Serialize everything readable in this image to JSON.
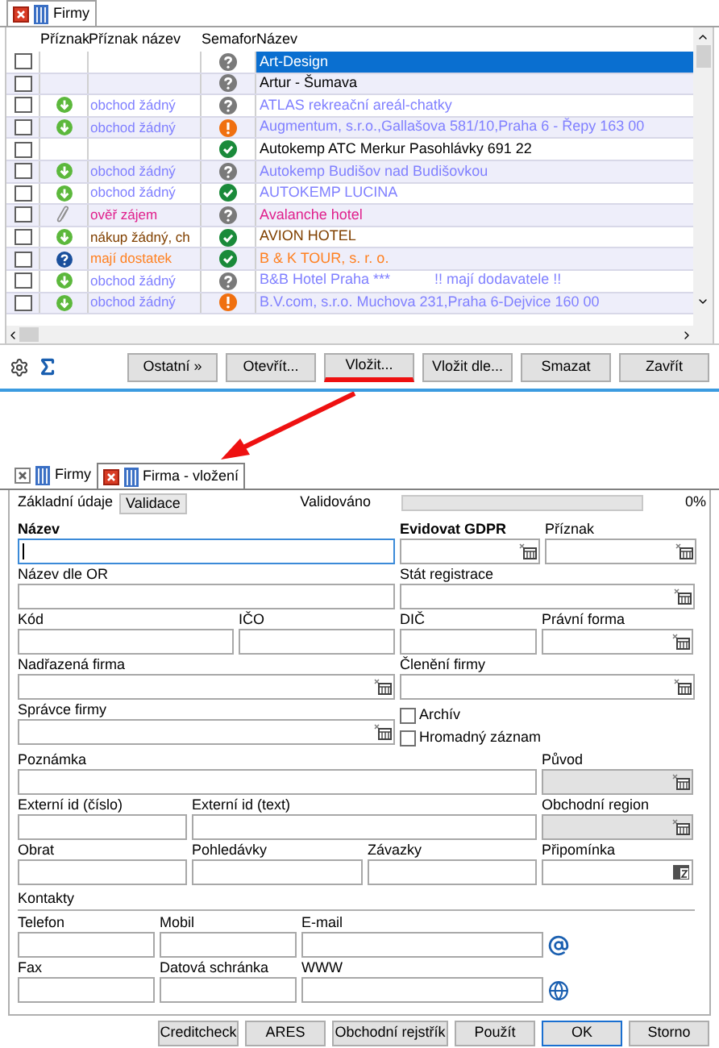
{
  "list_window": {
    "tabs": [
      {
        "label": "Firmy",
        "selected": true
      }
    ],
    "columns": [
      "Příznak",
      "Příznak název",
      "Semafor",
      "Název"
    ],
    "rows": [
      {
        "checked": false,
        "selected": true,
        "semafor": {
          "kind": "question"
        },
        "name": "Art-Design"
      },
      {
        "checked": false,
        "selected": false,
        "semafor": {
          "kind": "question"
        },
        "name": "Artur - Šumava",
        "color": "#000000"
      },
      {
        "checked": false,
        "selected": false,
        "flag": {
          "kind": "down",
          "label": "obchod žádný"
        },
        "semafor": {
          "kind": "question"
        },
        "name": "ATLAS rekreační areál-chatky",
        "color": "#8080ff"
      },
      {
        "checked": false,
        "selected": false,
        "flag": {
          "kind": "down",
          "label": "obchod žádný"
        },
        "semafor": {
          "kind": "warning"
        },
        "name": "Augmentum, s.r.o.,Gallašova 581/10,Praha 6 - Řepy 163 00",
        "color": "#8080ff"
      },
      {
        "checked": false,
        "selected": false,
        "semafor": {
          "kind": "ok"
        },
        "name": "Autokemp ATC Merkur Pasohlávky 691 22",
        "color": "#000000"
      },
      {
        "checked": false,
        "selected": false,
        "flag": {
          "kind": "down",
          "label": "obchod žádný"
        },
        "semafor": {
          "kind": "question"
        },
        "name": "Autokemp Budišov nad Budišovkou",
        "color": "#8080ff"
      },
      {
        "checked": false,
        "selected": false,
        "flag": {
          "kind": "down",
          "label": "obchod žádný"
        },
        "semafor": {
          "kind": "ok"
        },
        "name": "AUTOKEMP LUCINA",
        "color": "#8080ff"
      },
      {
        "checked": false,
        "selected": false,
        "flag": {
          "kind": "clip",
          "label": "ověř zájem"
        },
        "semafor": {
          "kind": "question"
        },
        "name": "Avalanche hotel",
        "color": "#e0208c"
      },
      {
        "checked": false,
        "selected": false,
        "flag": {
          "kind": "down",
          "label": "nákup žádný, ch"
        },
        "semafor": {
          "kind": "ok"
        },
        "name": "AVION HOTEL",
        "color": "#804000"
      },
      {
        "checked": false,
        "selected": false,
        "flag": {
          "kind": "question",
          "label": "mají dostatek"
        },
        "semafor": {
          "kind": "ok"
        },
        "name": "B & K TOUR, s. r. o.",
        "color": "#ff8020"
      },
      {
        "checked": false,
        "selected": false,
        "flag": {
          "kind": "down",
          "label": "obchod žádný"
        },
        "semafor": {
          "kind": "question"
        },
        "name": "B&B Hotel Praha ***           !! mají dodavatele !!",
        "color": "#8080ff"
      },
      {
        "checked": false,
        "selected": false,
        "flag": {
          "kind": "down",
          "label": "obchod žádný"
        },
        "semafor": {
          "kind": "warning"
        },
        "name": "B.V.com, s.r.o. Muchova 231,Praha 6-Dejvice 160 00",
        "color": "#8080ff"
      }
    ],
    "buttons": [
      {
        "label": "Ostatní »",
        "underlined": false
      },
      {
        "label": "Otevřít...",
        "underlined": false
      },
      {
        "label": "Vložit...",
        "underlined": true
      },
      {
        "label": "Vložit dle...",
        "underlined": false
      },
      {
        "label": "Smazat",
        "underlined": false
      },
      {
        "label": "Zavřít",
        "underlined": false
      }
    ]
  },
  "form_window": {
    "tabs": [
      {
        "label": "Firmy",
        "selected": false
      },
      {
        "label": "Firma - vložení",
        "selected": true
      }
    ],
    "subtabs": [
      {
        "label": "Základní údaje",
        "selected": true
      },
      {
        "label": "Validace",
        "selected": false
      }
    ],
    "progress": {
      "label": "Validováno",
      "level": 0,
      "reading": "0%"
    },
    "fields": [
      {
        "label": "Název",
        "kind": "text",
        "required": true,
        "focused": true,
        "disabled": false
      },
      {
        "label": "Evidovat GDPR",
        "kind": "lookup",
        "required": true,
        "focused": false,
        "disabled": false
      },
      {
        "label": "Příznak",
        "kind": "lookup",
        "required": false,
        "focused": false,
        "disabled": false
      },
      {
        "label": "Název dle OR",
        "kind": "text",
        "required": false,
        "focused": false,
        "disabled": false
      },
      {
        "label": "Stát registrace",
        "kind": "lookup",
        "required": false,
        "focused": false,
        "disabled": false
      },
      {
        "label": "Kód",
        "kind": "text",
        "required": false,
        "focused": false,
        "disabled": false
      },
      {
        "label": "IČO",
        "kind": "text",
        "required": false,
        "focused": false,
        "disabled": false
      },
      {
        "label": "DIČ",
        "kind": "text",
        "required": false,
        "focused": false,
        "disabled": false
      },
      {
        "label": "Právní forma",
        "kind": "lookup",
        "required": false,
        "focused": false,
        "disabled": false
      },
      {
        "label": "Nadřazená firma",
        "kind": "lookup",
        "required": false,
        "focused": false,
        "disabled": false
      },
      {
        "label": "Členění firmy",
        "kind": "lookup",
        "required": false,
        "focused": false,
        "disabled": false
      },
      {
        "label": "Správce firmy",
        "kind": "lookup",
        "required": false,
        "focused": false,
        "disabled": false
      },
      {
        "label": "Archív",
        "kind": "checkbox",
        "checked": false
      },
      {
        "label": "Hromadný záznam",
        "kind": "checkbox",
        "checked": false
      },
      {
        "label": "Poznámka",
        "kind": "text",
        "required": false,
        "focused": false,
        "disabled": false
      },
      {
        "label": "Původ",
        "kind": "lookup",
        "required": false,
        "focused": false,
        "disabled": true
      },
      {
        "label": "Externí id (číslo)",
        "kind": "text",
        "required": false,
        "focused": false,
        "disabled": false
      },
      {
        "label": "Externí id (text)",
        "kind": "text",
        "required": false,
        "focused": false,
        "disabled": false
      },
      {
        "label": "Obchodní region",
        "kind": "lookup",
        "required": false,
        "focused": false,
        "disabled": true
      },
      {
        "label": "Obrat",
        "kind": "text",
        "required": false,
        "focused": false,
        "disabled": false
      },
      {
        "label": "Pohledávky",
        "kind": "text",
        "required": false,
        "focused": false,
        "disabled": false
      },
      {
        "label": "Závazky",
        "kind": "text",
        "required": false,
        "focused": false,
        "disabled": false
      },
      {
        "label": "Připomínka",
        "kind": "memo",
        "required": false,
        "focused": false,
        "disabled": false
      }
    ],
    "contacts_heading": "Kontakty",
    "contact_fields": [
      {
        "label": "Telefon",
        "kind": "text",
        "required": false,
        "focused": false,
        "disabled": false
      },
      {
        "label": "Mobil",
        "kind": "text",
        "required": false,
        "focused": false,
        "disabled": false
      },
      {
        "label": "E-mail",
        "kind": "text",
        "required": false,
        "focused": false,
        "disabled": false
      },
      {
        "label": "Fax",
        "kind": "text",
        "required": false,
        "focused": false,
        "disabled": false
      },
      {
        "label": "Datová schránka",
        "kind": "text",
        "required": false,
        "focused": false,
        "disabled": false
      },
      {
        "label": "WWW",
        "kind": "text",
        "required": false,
        "focused": false,
        "disabled": false
      }
    ],
    "buttons": [
      {
        "label": "Creditcheck",
        "default": false
      },
      {
        "label": "ARES",
        "default": false
      },
      {
        "label": "Obchodní rejstřík",
        "default": false
      },
      {
        "label": "Použít",
        "default": false
      },
      {
        "label": "OK",
        "default": true
      },
      {
        "label": "Storno",
        "default": false
      }
    ]
  }
}
